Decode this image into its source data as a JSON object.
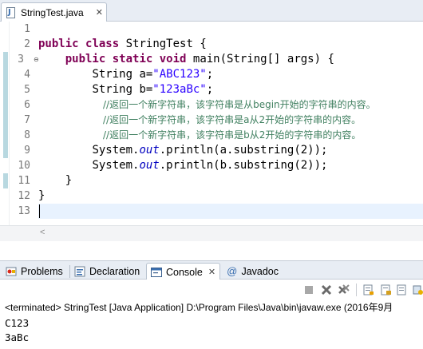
{
  "editor_tab": {
    "filename": "StringTest.java",
    "close": "✕"
  },
  "line_numbers": [
    "1",
    "2",
    "3",
    "4",
    "5",
    "6",
    "7",
    "8",
    "9",
    "10",
    "11",
    "12",
    "13"
  ],
  "code": {
    "l2": {
      "kw1": "public",
      "kw2": "class",
      "rest": " StringTest {"
    },
    "l3": {
      "kw1": "public",
      "kw2": "static",
      "kw3": "void",
      "rest": " main(String[] args) {"
    },
    "l4": {
      "pre": "String a=",
      "str": "\"ABC123\"",
      "post": ";"
    },
    "l5": {
      "pre": "String b=",
      "str": "\"123aBc\"",
      "post": ";"
    },
    "l6": {
      "comment": "//返回一个新字符串，该字符串是从begin开始的字符串的内容。"
    },
    "l7": {
      "comment": "//返回一个新字符串，该字符串是a从2开始的字符串的内容。"
    },
    "l8": {
      "comment": "//返回一个新字符串，该字符串是b从2开始的字符串的内容。"
    },
    "l9": {
      "pre": "System.",
      "stat": "out",
      "post": ".println(a.substring(2));"
    },
    "l10": {
      "pre": "System.",
      "stat": "out",
      "post": ".println(b.substring(2));"
    },
    "l11": {
      "text": "}"
    },
    "l12": {
      "text": "}"
    }
  },
  "views": {
    "tabs": [
      {
        "label": "Problems",
        "icon": "problems-icon"
      },
      {
        "label": "Declaration",
        "icon": "declaration-icon"
      },
      {
        "label": "Console",
        "icon": "console-icon",
        "close": "✕"
      },
      {
        "label": "Javadoc",
        "icon": "javadoc-icon"
      }
    ]
  },
  "console": {
    "status": "<terminated> StringTest [Java Application] D:\\Program Files\\Java\\bin\\javaw.exe (2016年9月",
    "output": [
      "C123",
      "3aBc"
    ]
  },
  "colors": {
    "keyword": "#7f0055",
    "string": "#2a00ff",
    "comment": "#3f7f5f",
    "static_field": "#0000c0",
    "current_line": "#e8f2fe"
  }
}
